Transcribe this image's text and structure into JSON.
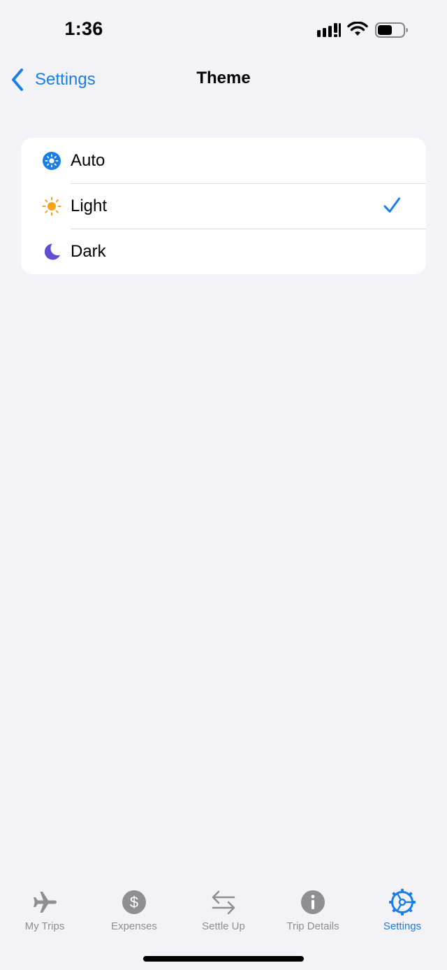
{
  "status_bar": {
    "time": "1:36"
  },
  "nav": {
    "back_label": "Settings",
    "title": "Theme"
  },
  "theme_options": {
    "items": [
      {
        "label": "Auto",
        "icon": "auto-brightness-icon",
        "selected": false
      },
      {
        "label": "Light",
        "icon": "sun-icon",
        "selected": true
      },
      {
        "label": "Dark",
        "icon": "moon-icon",
        "selected": false
      }
    ]
  },
  "tab_bar": {
    "items": [
      {
        "label": "My Trips",
        "icon": "airplane-icon",
        "active": false
      },
      {
        "label": "Expenses",
        "icon": "dollar-circle-icon",
        "active": false
      },
      {
        "label": "Settle Up",
        "icon": "arrows-swap-icon",
        "active": false
      },
      {
        "label": "Trip Details",
        "icon": "info-circle-icon",
        "active": false
      },
      {
        "label": "Settings",
        "icon": "gear-icon",
        "active": true
      }
    ]
  },
  "colors": {
    "accent": "#1a7ee6",
    "background": "#f2f2f7",
    "inactive_tab": "#8e8e93",
    "sun": "#f7a21b",
    "moon": "#5e4fd3"
  }
}
